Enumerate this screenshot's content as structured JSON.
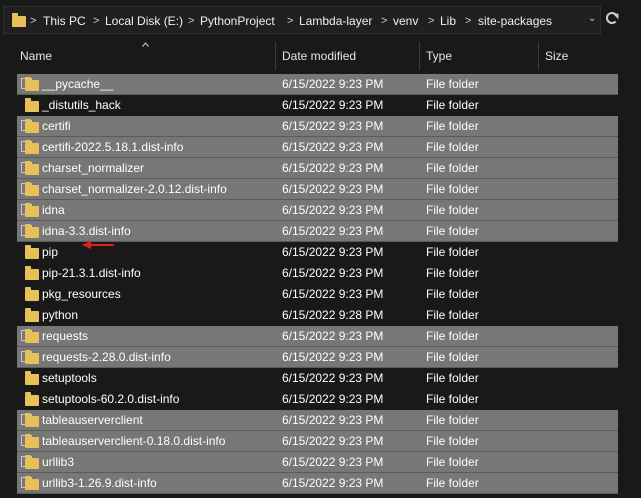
{
  "address_bar": {
    "folder_icon": "folder-icon",
    "crumbs": [
      "This PC",
      "Local Disk (E:)",
      "PythonProject",
      "Lambda-layer",
      "venv",
      "Lib",
      "site-packages"
    ],
    "separator": ">",
    "dropdown_icon": "chevron-down-icon",
    "refresh_icon": "refresh-icon"
  },
  "columns": {
    "name": "Name",
    "date": "Date modified",
    "type": "Type",
    "size": "Size",
    "sort_icon": "sort-ascending-icon"
  },
  "rows": [
    {
      "name": "__pycache__",
      "date": "6/15/2022 9:23 PM",
      "type": "File folder",
      "size": "",
      "selected": true
    },
    {
      "name": "_distutils_hack",
      "date": "6/15/2022 9:23 PM",
      "type": "File folder",
      "size": "",
      "selected": false
    },
    {
      "name": "certifi",
      "date": "6/15/2022 9:23 PM",
      "type": "File folder",
      "size": "",
      "selected": true
    },
    {
      "name": "certifi-2022.5.18.1.dist-info",
      "date": "6/15/2022 9:23 PM",
      "type": "File folder",
      "size": "",
      "selected": true
    },
    {
      "name": "charset_normalizer",
      "date": "6/15/2022 9:23 PM",
      "type": "File folder",
      "size": "",
      "selected": true
    },
    {
      "name": "charset_normalizer-2.0.12.dist-info",
      "date": "6/15/2022 9:23 PM",
      "type": "File folder",
      "size": "",
      "selected": true
    },
    {
      "name": "idna",
      "date": "6/15/2022 9:23 PM",
      "type": "File folder",
      "size": "",
      "selected": true
    },
    {
      "name": "idna-3.3.dist-info",
      "date": "6/15/2022 9:23 PM",
      "type": "File folder",
      "size": "",
      "selected": true
    },
    {
      "name": "pip",
      "date": "6/15/2022 9:23 PM",
      "type": "File folder",
      "size": "",
      "selected": false
    },
    {
      "name": "pip-21.3.1.dist-info",
      "date": "6/15/2022 9:23 PM",
      "type": "File folder",
      "size": "",
      "selected": false
    },
    {
      "name": "pkg_resources",
      "date": "6/15/2022 9:23 PM",
      "type": "File folder",
      "size": "",
      "selected": false
    },
    {
      "name": "python",
      "date": "6/15/2022 9:28 PM",
      "type": "File folder",
      "size": "",
      "selected": false
    },
    {
      "name": "requests",
      "date": "6/15/2022 9:23 PM",
      "type": "File folder",
      "size": "",
      "selected": true
    },
    {
      "name": "requests-2.28.0.dist-info",
      "date": "6/15/2022 9:23 PM",
      "type": "File folder",
      "size": "",
      "selected": true
    },
    {
      "name": "setuptools",
      "date": "6/15/2022 9:23 PM",
      "type": "File folder",
      "size": "",
      "selected": false
    },
    {
      "name": "setuptools-60.2.0.dist-info",
      "date": "6/15/2022 9:23 PM",
      "type": "File folder",
      "size": "",
      "selected": false
    },
    {
      "name": "tableauserverclient",
      "date": "6/15/2022 9:23 PM",
      "type": "File folder",
      "size": "",
      "selected": true
    },
    {
      "name": "tableauserverclient-0.18.0.dist-info",
      "date": "6/15/2022 9:23 PM",
      "type": "File folder",
      "size": "",
      "selected": true
    },
    {
      "name": "urllib3",
      "date": "6/15/2022 9:23 PM",
      "type": "File folder",
      "size": "",
      "selected": true
    },
    {
      "name": "urllib3-1.26.9.dist-info",
      "date": "6/15/2022 9:23 PM",
      "type": "File folder",
      "size": "",
      "selected": true
    }
  ],
  "row_folder_icon": "folder-icon",
  "annotation_icon": "red-arrow-icon",
  "colors": {
    "background": "#191919",
    "selected_row": "#777777",
    "folder": "#e8c05a",
    "annotation": "#e02020"
  }
}
